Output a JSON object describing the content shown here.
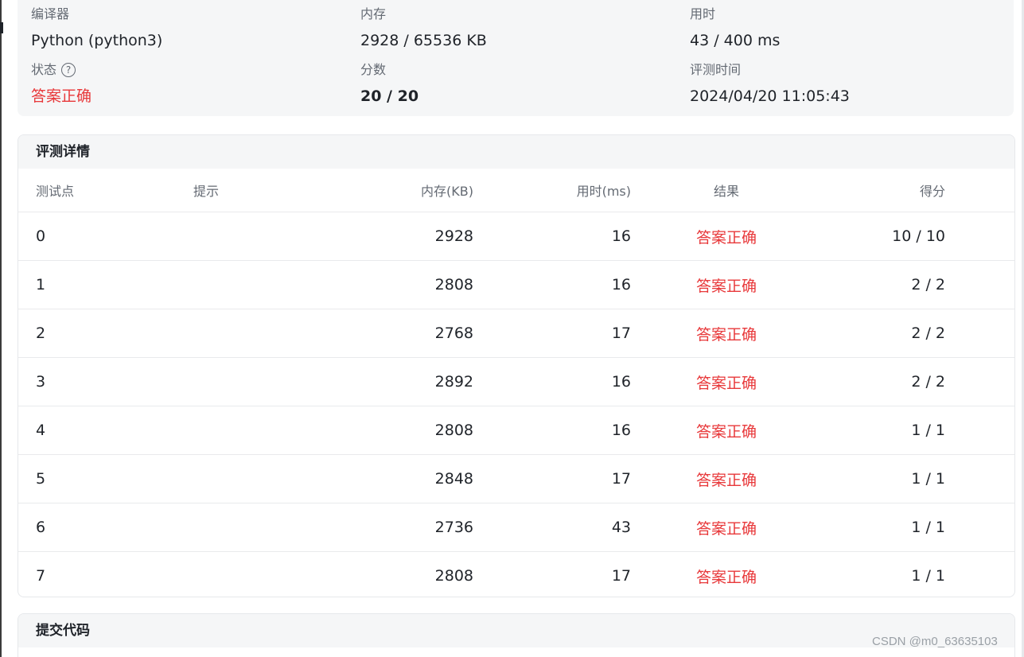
{
  "summary": {
    "compiler": {
      "label": "编译器",
      "value": "Python (python3)"
    },
    "memory": {
      "label": "内存",
      "value": "2928 / 65536 KB"
    },
    "time": {
      "label": "用时",
      "value": "43 / 400 ms"
    },
    "status": {
      "label": "状态",
      "value": "答案正确",
      "help_icon": "question-circle-icon",
      "color": "#e8383a"
    },
    "score": {
      "label": "分数",
      "value": "20 / 20"
    },
    "judge_time": {
      "label": "评测时间",
      "value": "2024/04/20 11:05:43"
    }
  },
  "details": {
    "title": "评测详情",
    "headers": {
      "id": "测试点",
      "hint": "提示",
      "memory": "内存(KB)",
      "time": "用时(ms)",
      "result": "结果",
      "score": "得分"
    },
    "rows": [
      {
        "id": "0",
        "hint": "",
        "memory": "2928",
        "time": "16",
        "result": "答案正确",
        "score": "10 / 10"
      },
      {
        "id": "1",
        "hint": "",
        "memory": "2808",
        "time": "16",
        "result": "答案正确",
        "score": "2 / 2"
      },
      {
        "id": "2",
        "hint": "",
        "memory": "2768",
        "time": "17",
        "result": "答案正确",
        "score": "2 / 2"
      },
      {
        "id": "3",
        "hint": "",
        "memory": "2892",
        "time": "16",
        "result": "答案正确",
        "score": "2 / 2"
      },
      {
        "id": "4",
        "hint": "",
        "memory": "2808",
        "time": "16",
        "result": "答案正确",
        "score": "1 / 1"
      },
      {
        "id": "5",
        "hint": "",
        "memory": "2848",
        "time": "17",
        "result": "答案正确",
        "score": "1 / 1"
      },
      {
        "id": "6",
        "hint": "",
        "memory": "2736",
        "time": "43",
        "result": "答案正确",
        "score": "1 / 1"
      },
      {
        "id": "7",
        "hint": "",
        "memory": "2808",
        "time": "17",
        "result": "答案正确",
        "score": "1 / 1"
      }
    ]
  },
  "code_panel": {
    "title": "提交代码"
  },
  "watermark": "CSDN @m0_63635103"
}
